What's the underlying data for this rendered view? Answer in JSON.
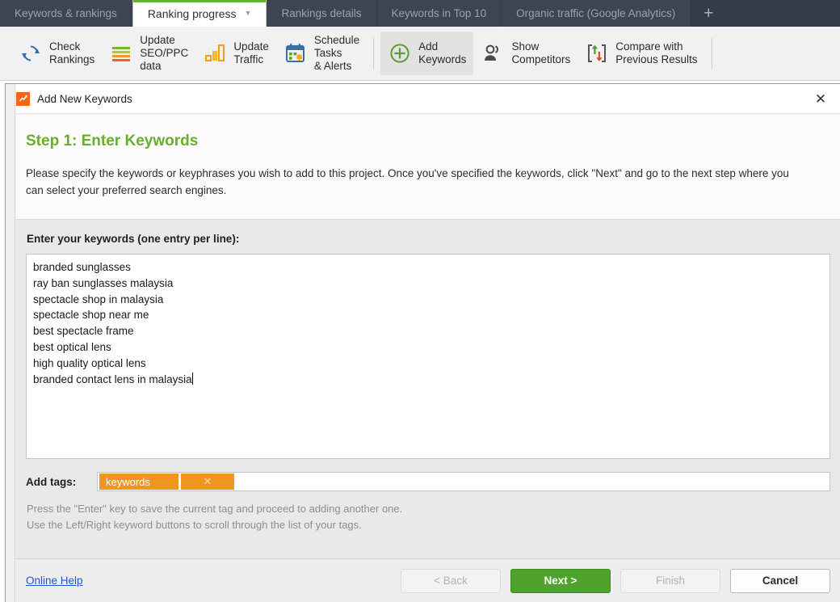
{
  "tabs": [
    {
      "label": "Keywords & rankings",
      "active": false
    },
    {
      "label": "Ranking progress",
      "active": true,
      "chevron": "chevron-down-icon"
    },
    {
      "label": "Rankings details",
      "active": false
    },
    {
      "label": "Keywords in Top 10",
      "active": false
    },
    {
      "label": "Organic traffic (Google Analytics)",
      "active": false
    }
  ],
  "tab_add_label": "+",
  "toolbar": {
    "items": [
      {
        "icon": "refresh-circle-icon",
        "label": "Check\nRankings",
        "highlight": false
      },
      {
        "icon": "bars-stack-icon",
        "label": "Update\nSEO/PPC\ndata",
        "highlight": false
      },
      {
        "icon": "bar-chart-icon",
        "label": "Update\nTraffic",
        "highlight": false
      },
      {
        "icon": "calendar-alert-icon",
        "label": "Schedule\nTasks\n& Alerts",
        "highlight": false
      },
      {
        "icon": "plus-circle-icon",
        "label": "Add\nKeywords",
        "highlight": true
      },
      {
        "icon": "people-icon",
        "label": "Show\nCompetitors",
        "highlight": false
      },
      {
        "icon": "compare-arrows-icon",
        "label": "Compare with\nPrevious Results",
        "highlight": false
      }
    ]
  },
  "dialog": {
    "app_icon": "rank-tracker-icon",
    "title": "Add New Keywords",
    "close_label": "✕",
    "step_title": "Step 1: Enter Keywords",
    "step_description": "Please specify the keywords or keyphrases you wish to add to this project. Once you've specified the keywords, click \"Next\" and go to the next step where you can select your preferred search engines.",
    "keywords_label": "Enter your keywords (one entry per line):",
    "keywords": [
      "branded sunglasses",
      "ray ban sunglasses malaysia",
      "spectacle shop in malaysia",
      "spectacle shop near me",
      "best spectacle frame",
      "best optical lens",
      "high quality optical lens",
      "branded contact lens in malaysia"
    ],
    "tags_label": "Add tags:",
    "tag_value": "keywords",
    "tag_delete_label": "✕",
    "hint_line1": "Press the \"Enter\" key to save the current tag and proceed to adding another one.",
    "hint_line2": "Use the Left/Right keyword buttons to scroll through the list of your tags.",
    "help_link": "Online Help",
    "buttons": {
      "back": "< Back",
      "next": "Next >",
      "finish": "Finish",
      "cancel": "Cancel"
    }
  },
  "colors": {
    "accent_green": "#4ea32a",
    "step_green": "#6aad2e",
    "tag_orange": "#f0961e",
    "tab_active_bar": "#62b32b",
    "tabbar_bg": "#343b4a",
    "link_blue": "#2255cc"
  }
}
